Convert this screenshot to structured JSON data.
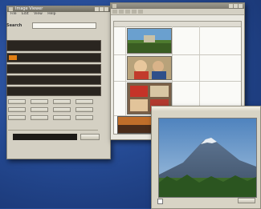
{
  "left_window": {
    "title": "Image Viewer",
    "menu": [
      "File",
      "Edit",
      "View",
      "Help"
    ],
    "input_label": "Search",
    "input_value": "",
    "list_items": [
      "",
      "",
      "",
      "",
      ""
    ],
    "status": ""
  },
  "middle_window": {
    "title": "",
    "columns": [
      "",
      "",
      "",
      ""
    ],
    "rows": [
      {
        "c1": "",
        "c3": "",
        "c4": ""
      },
      {
        "c1": "",
        "c3": "",
        "c4": ""
      },
      {
        "c1": "",
        "c3": "",
        "c4": ""
      }
    ]
  },
  "preview_window": {
    "title": "",
    "checkbox_label": "",
    "button_label": ""
  },
  "colors": {
    "desktop": "#254a93",
    "accent_orange": "#e07e14",
    "dark_panel": "#2a2520"
  }
}
